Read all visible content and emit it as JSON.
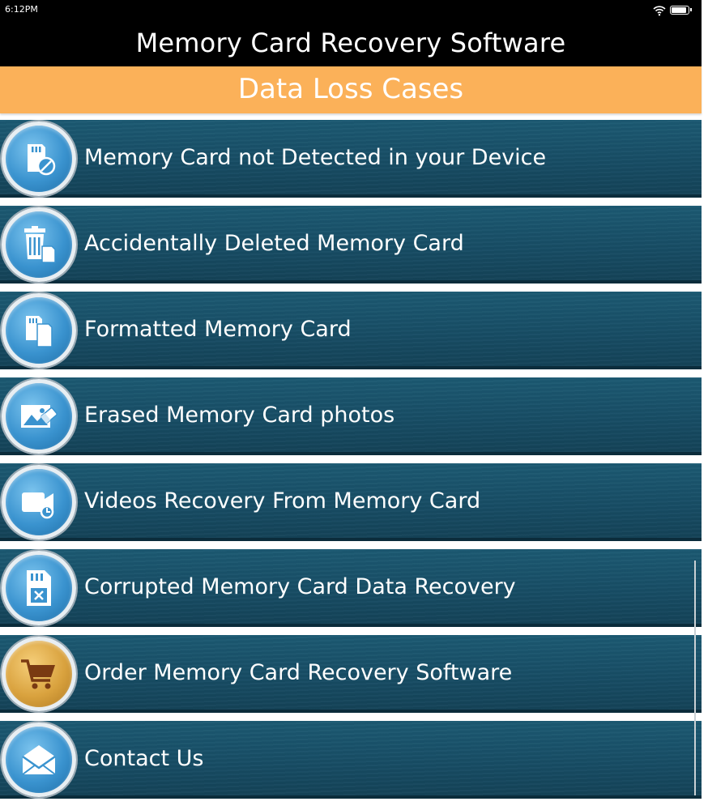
{
  "status_bar": {
    "time": "6:12PM",
    "wifi_icon": "wifi-icon",
    "battery_icon": "battery-icon"
  },
  "app": {
    "title": "Memory Card Recovery Software"
  },
  "section": {
    "title": "Data Loss Cases",
    "color": "#fbb159"
  },
  "menu": {
    "items": [
      {
        "label": "Memory Card not Detected in your Device",
        "icon": "sd-card-blocked-icon"
      },
      {
        "label": "Accidentally Deleted Memory Card",
        "icon": "trash-memory-card-icon"
      },
      {
        "label": "Formatted Memory Card",
        "icon": "memory-cards-icon"
      },
      {
        "label": "Erased Memory Card photos",
        "icon": "photo-eraser-icon"
      },
      {
        "label": "Videos Recovery From Memory Card",
        "icon": "video-camera-recover-icon"
      },
      {
        "label": "Corrupted Memory Card Data Recovery",
        "icon": "corrupted-sd-card-icon"
      },
      {
        "label": "Order Memory Card Recovery Software",
        "icon": "shopping-cart-icon"
      },
      {
        "label": "Contact Us",
        "icon": "envelope-icon"
      }
    ]
  },
  "colors": {
    "item_background": "#174c64",
    "icon_blue": "#3a93cf",
    "icon_gold": "#d9a23e"
  }
}
